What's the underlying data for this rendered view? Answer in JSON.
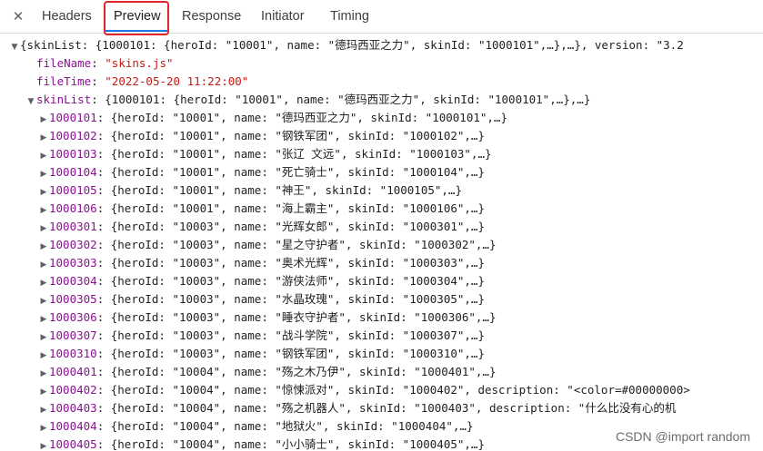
{
  "tabs": {
    "close_glyph": "✕",
    "items": [
      {
        "label": "Headers"
      },
      {
        "label": "Preview"
      },
      {
        "label": "Response"
      },
      {
        "label": "Initiator"
      },
      {
        "label": "Timing"
      }
    ],
    "active_label": "Preview"
  },
  "tree": {
    "root_preview": "{skinList: {1000101: {heroId: \"10001\", name: \"德玛西亚之力\", skinId: \"1000101\",…},…}, version: \"3.2",
    "file_name": {
      "key": "fileName",
      "value": "\"skins.js\""
    },
    "file_time": {
      "key": "fileTime",
      "value": "\"2022-05-20 11:22:00\""
    },
    "skin_list": {
      "key": "skinList",
      "preview": "{1000101: {heroId: \"10001\", name: \"德玛西亚之力\", skinId: \"1000101\",…},…}"
    },
    "entries": [
      {
        "key": "1000101",
        "preview": "{heroId: \"10001\", name: \"德玛西亚之力\", skinId: \"1000101\",…}"
      },
      {
        "key": "1000102",
        "preview": "{heroId: \"10001\", name: \"钢铁军团\", skinId: \"1000102\",…}"
      },
      {
        "key": "1000103",
        "preview": "{heroId: \"10001\", name: \"张辽 文远\", skinId: \"1000103\",…}"
      },
      {
        "key": "1000104",
        "preview": "{heroId: \"10001\", name: \"死亡骑士\", skinId: \"1000104\",…}"
      },
      {
        "key": "1000105",
        "preview": "{heroId: \"10001\", name: \"神王\", skinId: \"1000105\",…}"
      },
      {
        "key": "1000106",
        "preview": "{heroId: \"10001\", name: \"海上霸主\", skinId: \"1000106\",…}"
      },
      {
        "key": "1000301",
        "preview": "{heroId: \"10003\", name: \"光辉女郎\", skinId: \"1000301\",…}"
      },
      {
        "key": "1000302",
        "preview": "{heroId: \"10003\", name: \"星之守护者\", skinId: \"1000302\",…}"
      },
      {
        "key": "1000303",
        "preview": "{heroId: \"10003\", name: \"奥术光辉\", skinId: \"1000303\",…}"
      },
      {
        "key": "1000304",
        "preview": "{heroId: \"10003\", name: \"游侠法师\", skinId: \"1000304\",…}"
      },
      {
        "key": "1000305",
        "preview": "{heroId: \"10003\", name: \"水晶玫瑰\", skinId: \"1000305\",…}"
      },
      {
        "key": "1000306",
        "preview": "{heroId: \"10003\", name: \"睡衣守护者\", skinId: \"1000306\",…}"
      },
      {
        "key": "1000307",
        "preview": "{heroId: \"10003\", name: \"战斗学院\", skinId: \"1000307\",…}"
      },
      {
        "key": "1000310",
        "preview": "{heroId: \"10003\", name: \"钢铁军团\", skinId: \"1000310\",…}"
      },
      {
        "key": "1000401",
        "preview": "{heroId: \"10004\", name: \"殇之木乃伊\", skinId: \"1000401\",…}"
      },
      {
        "key": "1000402",
        "preview": "{heroId: \"10004\", name: \"惊悚派对\", skinId: \"1000402\", description: \"<color=#00000000>"
      },
      {
        "key": "1000403",
        "preview": "{heroId: \"10004\", name: \"殇之机器人\", skinId: \"1000403\", description: \"什么比没有心的机"
      },
      {
        "key": "1000404",
        "preview": "{heroId: \"10004\", name: \"地狱火\", skinId: \"1000404\",…}"
      },
      {
        "key": "1000405",
        "preview": "{heroId: \"10004\", name: \"小小骑士\", skinId: \"1000405\",…}"
      }
    ]
  },
  "watermark": "CSDN @import random",
  "colors": {
    "key": "#881391",
    "string": "#c41a16",
    "active_tab_underline": "#1a73e8",
    "annotation_box": "#e0262b"
  },
  "icons": {
    "expanded": "▼",
    "collapsed": "▶"
  }
}
